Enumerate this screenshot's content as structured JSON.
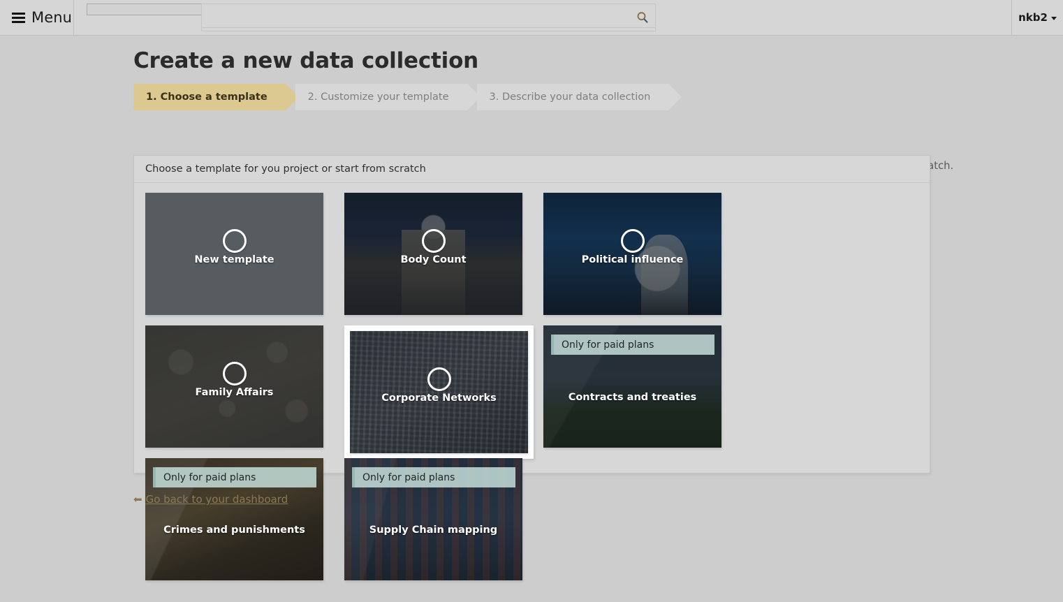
{
  "topbar": {
    "menu_label": "Menu",
    "menu_icon": "hamburger-icon",
    "mini_field_value": "",
    "search_value": "",
    "search_placeholder": "",
    "search_icon": "search-icon",
    "user_name": "nkb2",
    "user_caret_icon": "chevron-down-icon"
  },
  "page": {
    "title": "Create a new data collection",
    "lead": "Think of the data structure as the foundations of your data collection. Choose a template that fits to your goal and customize it, or you can start from scratch.",
    "back_link": {
      "label": "Go back to your dashboard",
      "icon": "arrow-left-icon"
    }
  },
  "steps": [
    {
      "label": "1. Choose a template",
      "state": "active"
    },
    {
      "label": "2. Customize your template",
      "state": "idle"
    },
    {
      "label": "3. Describe your data collection",
      "state": "idle"
    }
  ],
  "panel": {
    "header": "Choose a template for you project or start from scratch",
    "templates": [
      {
        "label": "New template",
        "art": "art-new",
        "selected": false,
        "paid": false,
        "radio": true,
        "paid_label": ""
      },
      {
        "label": "Body Count",
        "art": "art-body",
        "selected": false,
        "paid": false,
        "radio": true,
        "paid_label": ""
      },
      {
        "label": "Political influence",
        "art": "art-political",
        "selected": false,
        "paid": false,
        "radio": true,
        "paid_label": ""
      },
      {
        "label": "Family Affairs",
        "art": "art-family",
        "selected": false,
        "paid": false,
        "radio": true,
        "paid_label": ""
      },
      {
        "label": "Corporate Networks",
        "art": "art-corporate",
        "selected": true,
        "paid": false,
        "radio": true,
        "paid_label": ""
      },
      {
        "label": "Contracts and treaties",
        "art": "art-contracts",
        "selected": false,
        "paid": true,
        "radio": false,
        "paid_label": "Only for paid plans"
      },
      {
        "label": "Crimes and punishments",
        "art": "art-crimes",
        "selected": false,
        "paid": true,
        "radio": false,
        "paid_label": "Only for paid plans"
      },
      {
        "label": "Supply Chain mapping",
        "art": "art-supply",
        "selected": false,
        "paid": true,
        "radio": false,
        "paid_label": "Only for paid plans"
      }
    ]
  },
  "colors": {
    "page_bg": "#cdcdcd",
    "panel_bg": "#d7d7d7",
    "step_active_bg": "#dcc98f",
    "step_idle_bg": "#d7d7d7",
    "paid_badge_bg": "#c4ddd8",
    "link": "#8b7a53"
  }
}
